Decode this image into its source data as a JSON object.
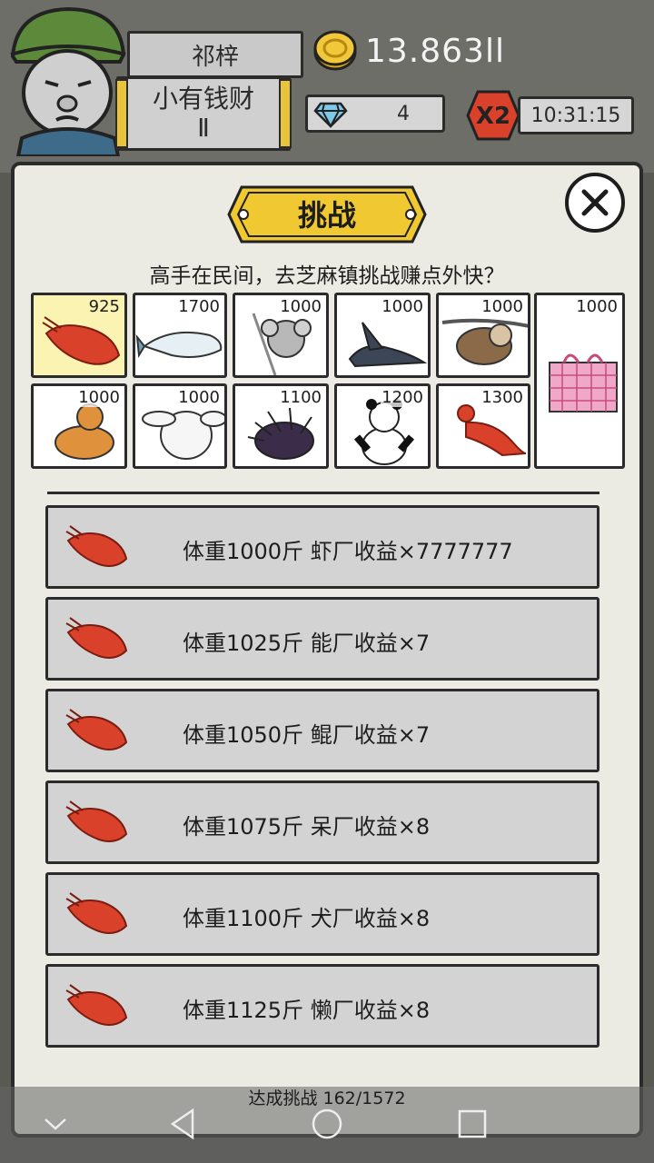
{
  "header": {
    "player_name": "祁梓",
    "rank_title": "小有钱财Ⅱ",
    "coins": "13.863ll",
    "gems": "4",
    "multiplier": "X2",
    "timer": "10:31:15"
  },
  "panel": {
    "title": "挑战",
    "subtitle": "高手在民间，去芝麻镇挑战赚点外快？"
  },
  "animals": [
    {
      "cost": "925",
      "icon": "shrimp-icon"
    },
    {
      "cost": "1700",
      "icon": "fish-icon"
    },
    {
      "cost": "1000",
      "icon": "koala-icon"
    },
    {
      "cost": "1000",
      "icon": "wolf-icon"
    },
    {
      "cost": "1000",
      "icon": "sloth-icon"
    },
    {
      "cost": "1000",
      "icon": "bag-icon"
    },
    {
      "cost": "1000",
      "icon": "cat-icon"
    },
    {
      "cost": "1000",
      "icon": "rabbit-icon"
    },
    {
      "cost": "1100",
      "icon": "porcupine-icon"
    },
    {
      "cost": "1200",
      "icon": "panda-icon"
    },
    {
      "cost": "1300",
      "icon": "lobster-icon"
    }
  ],
  "challenges": [
    {
      "text": "体重1000斤  虾厂收益×7777777"
    },
    {
      "text": "体重1025斤  能厂收益×7"
    },
    {
      "text": "体重1050斤  鲲厂收益×7"
    },
    {
      "text": "体重1075斤  呆厂收益×8"
    },
    {
      "text": "体重1100斤  犬厂收益×8"
    },
    {
      "text": "体重1125斤  懒厂收益×8"
    }
  ],
  "footer": {
    "progress": "达成挑战 162/1572"
  },
  "colors": {
    "accent_yellow": "#f0c832",
    "shrimp_red": "#d9412b",
    "row_bg": "#d3d3d3"
  }
}
